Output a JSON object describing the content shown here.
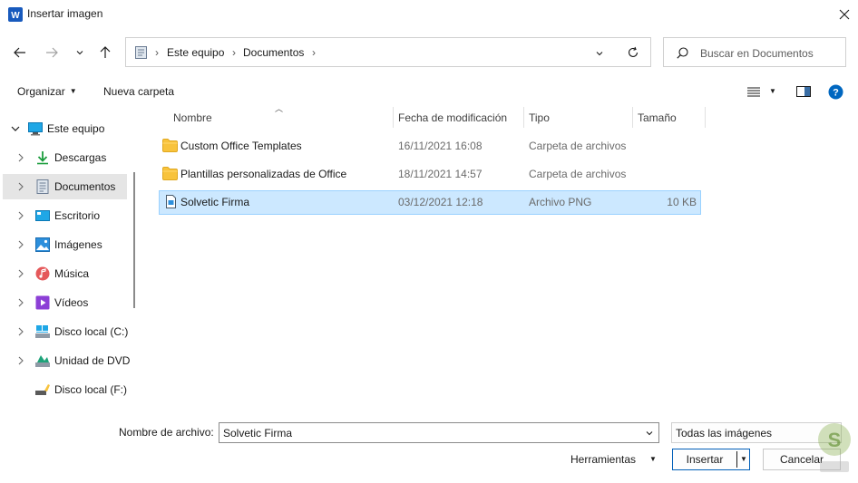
{
  "window": {
    "title": "Insertar imagen",
    "app_icon_letter": "W"
  },
  "address": {
    "crumbs": [
      "Este equipo",
      "Documentos"
    ]
  },
  "search": {
    "placeholder": "Buscar en Documentos"
  },
  "commands": {
    "organize": "Organizar",
    "new_folder": "Nueva carpeta"
  },
  "sidebar": {
    "items": [
      {
        "label": "Este equipo",
        "icon": "computer-icon",
        "expanded": true
      },
      {
        "label": "Descargas",
        "icon": "download-icon"
      },
      {
        "label": "Documentos",
        "icon": "documents-icon",
        "selected": true
      },
      {
        "label": "Escritorio",
        "icon": "desktop-icon"
      },
      {
        "label": "Imágenes",
        "icon": "pictures-icon"
      },
      {
        "label": "Música",
        "icon": "music-icon"
      },
      {
        "label": "Vídeos",
        "icon": "videos-icon"
      },
      {
        "label": "Disco local (C:)",
        "icon": "drive-icon"
      },
      {
        "label": "Unidad de DVD",
        "icon": "dvd-icon"
      },
      {
        "label": "Disco local (F:)",
        "icon": "usb-drive-icon"
      }
    ]
  },
  "columns": {
    "name": "Nombre",
    "date": "Fecha de modificación",
    "type": "Tipo",
    "size": "Tamaño"
  },
  "files": [
    {
      "name": "Custom Office Templates",
      "date": "16/11/2021 16:08",
      "type": "Carpeta de archivos",
      "size": "",
      "icon": "folder-icon"
    },
    {
      "name": "Plantillas personalizadas de Office",
      "date": "18/11/2021 14:57",
      "type": "Carpeta de archivos",
      "size": "",
      "icon": "folder-icon"
    },
    {
      "name": "Solvetic Firma",
      "date": "03/12/2021 12:18",
      "type": "Archivo PNG",
      "size": "10 KB",
      "icon": "image-file-icon",
      "selected": true
    }
  ],
  "footer": {
    "filename_label": "Nombre de archivo:",
    "filename_value": "Solvetic Firma",
    "filter_value": "Todas las imágenes",
    "tools_label": "Herramientas",
    "insert_label": "Insertar",
    "cancel_label": "Cancelar"
  },
  "colors": {
    "accent": "#005fb8",
    "selection": "#cce8ff",
    "folder": "#f8c33c",
    "sidebar_selected": "#e5e5e5"
  }
}
